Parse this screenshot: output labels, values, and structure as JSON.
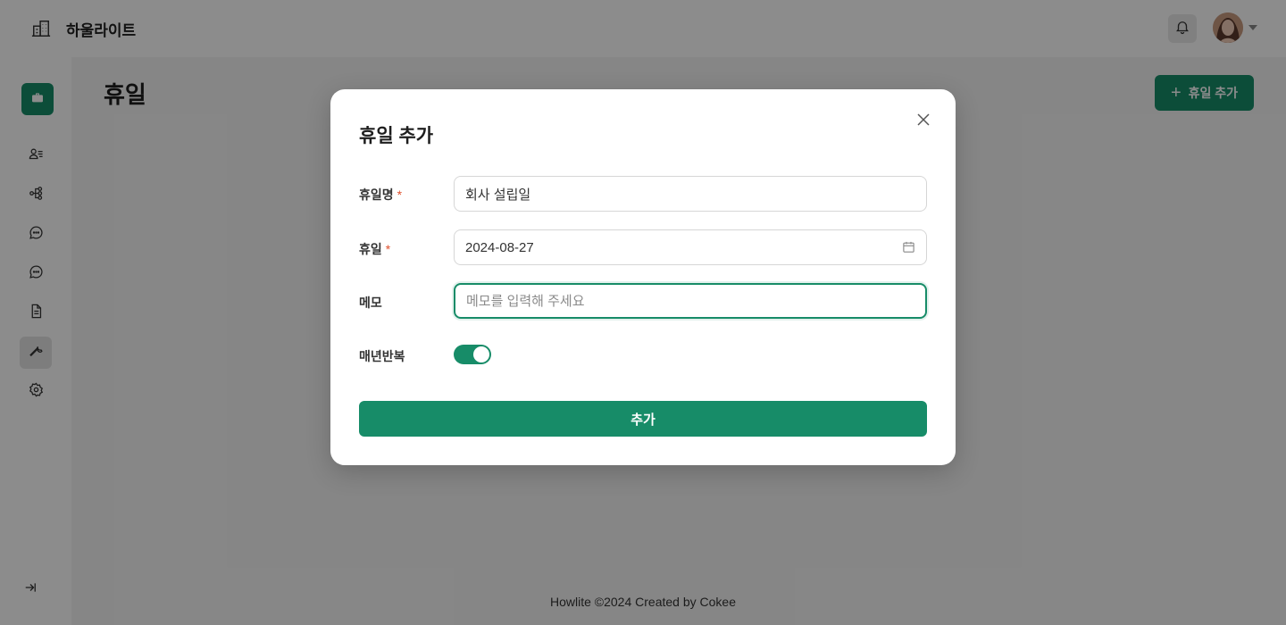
{
  "header": {
    "app_name": "하울라이트",
    "icons": {
      "brand": "building-icon",
      "notifications": "bell-icon",
      "avatar_caret": "caret-down-icon"
    }
  },
  "sidebar": {
    "logo_icon": "briefcase-icon",
    "items": [
      {
        "icon": "user-list-icon",
        "active": false
      },
      {
        "icon": "org-chart-icon",
        "active": false
      },
      {
        "icon": "chat-bubble-icon",
        "active": false
      },
      {
        "icon": "chat-bubble-icon",
        "active": false
      },
      {
        "icon": "document-icon",
        "active": false
      },
      {
        "icon": "wrench-icon",
        "active": true
      },
      {
        "icon": "settings-icon",
        "active": false
      }
    ],
    "collapse_icon": "collapse-right-icon"
  },
  "main": {
    "page_title": "휴일",
    "add_button_label": "휴일 추가",
    "add_button_icon": "plus-icon"
  },
  "footer": {
    "text": "Howlite ©2024 Created by Cokee"
  },
  "modal": {
    "title": "휴일 추가",
    "close_icon": "close-icon",
    "fields": {
      "holiday_name": {
        "label": "휴일명",
        "required_mark": "*",
        "value": "회사 설립일"
      },
      "holiday_date": {
        "label": "휴일",
        "required_mark": "*",
        "value": "2024-08-27",
        "icon": "calendar-icon"
      },
      "memo": {
        "label": "메모",
        "value": "",
        "placeholder": "메모를 입력해 주세요"
      },
      "repeat_yearly": {
        "label": "매년반복",
        "checked": true
      }
    },
    "submit_label": "추가"
  },
  "colors": {
    "accent": "#178c68",
    "required": "#e0512e",
    "overlay": "rgba(0,0,0,0.45)",
    "page_background": "#f5f5f5"
  }
}
